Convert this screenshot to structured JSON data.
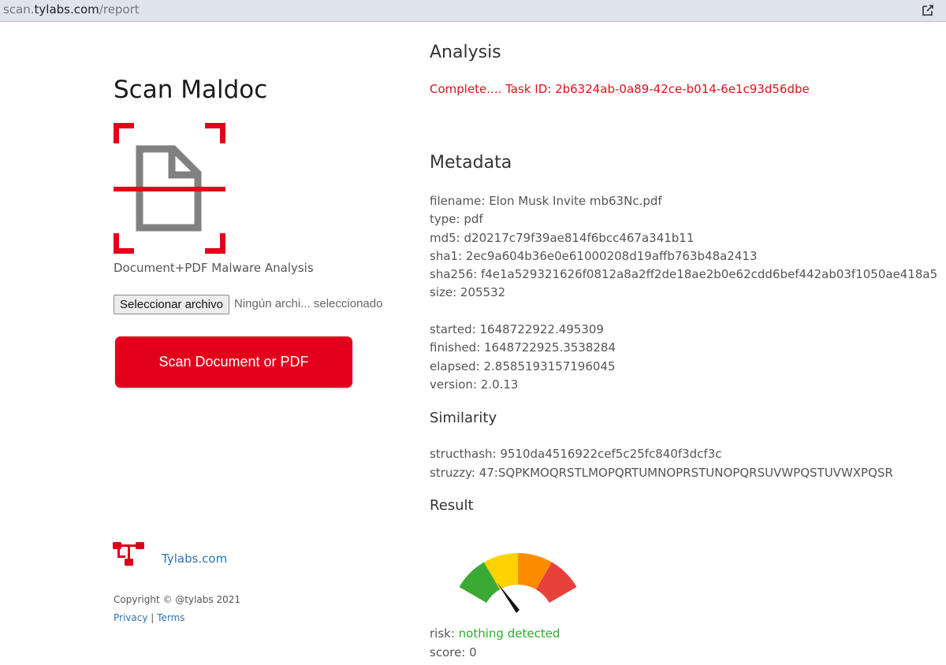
{
  "browser": {
    "url_host_prefix": "scan.",
    "url_host": "tylabs.com",
    "url_path": "/report",
    "action_icon": "share-edit-icon"
  },
  "left": {
    "title": "Scan Maldoc",
    "logo_icon": "document-scan-icon",
    "subtitle": "Document+PDF Malware Analysis",
    "file_button_label": "Seleccionar archivo",
    "file_status": "Ningún archi... seleccionado",
    "scan_button_label": "Scan Document or PDF",
    "footer": {
      "logo_icon": "network-nodes-icon",
      "site_link": "Tylabs.com",
      "copyright": "Copyright © @tylabs 2021",
      "privacy": "Privacy",
      "separator": "|",
      "terms": "Terms"
    }
  },
  "analysis": {
    "heading": "Analysis",
    "status": "Complete.... Task ID: 2b6324ab-0a89-42ce-b014-6e1c93d56dbe"
  },
  "metadata": {
    "heading": "Metadata",
    "filename": "filename: Elon Musk Invite mb63Nc.pdf",
    "type": "type: pdf",
    "md5": "md5: d20217c79f39ae814f6bcc467a341b11",
    "sha1": "sha1: 2ec9a604b36e0e61000208d19affb763b48a2413",
    "sha256": "sha256: f4e1a529321626f0812a8a2ff2de18ae2b0e62cdd6bef442ab03f1050ae418a5",
    "size": "size: 205532",
    "started": "started: 1648722922.495309",
    "finished": "finished: 1648722925.3538284",
    "elapsed": "elapsed: 2.8585193157196045",
    "version": "version: 2.0.13"
  },
  "similarity": {
    "heading": "Similarity",
    "structhash": "structhash: 9510da4516922cef5c25fc840f3dcf3c",
    "struzzy": "struzzy: 47:SQPKMOQRSTLMOPQRTUMNOPRSTUNOPQRSUVWPQSTUVWXPQSR"
  },
  "result": {
    "heading": "Result",
    "gauge_icon": "risk-gauge-icon",
    "gauge_level": 0.12,
    "gauge_colors": [
      "#3aaa35",
      "#ffd200",
      "#ff8c00",
      "#e8413c"
    ],
    "risk_label": "risk: ",
    "risk_value": "nothing detected",
    "score": "score: 0"
  },
  "colors": {
    "accent_red": "#e3001b",
    "status_red": "#e0121a",
    "link_blue": "#2a74b8",
    "ok_green": "#2fae2f"
  }
}
